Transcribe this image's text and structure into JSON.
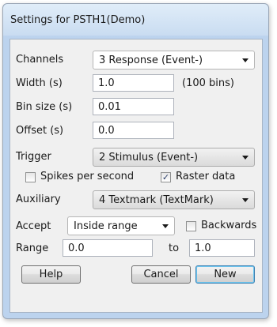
{
  "dialog": {
    "title": "Settings for PSTH1(Demo)"
  },
  "channels": {
    "label": "Channels",
    "value": "3 Response (Event-)"
  },
  "width": {
    "label": "Width (s)",
    "value": "1.0",
    "bins_note": "(100 bins)"
  },
  "bin_size": {
    "label": "Bin size (s)",
    "value": "0.01"
  },
  "offset": {
    "label": "Offset (s)",
    "value": "0.0"
  },
  "trigger": {
    "label": "Trigger",
    "value": "2 Stimulus (Event-)"
  },
  "spikes_per_second": {
    "label": "Spikes per second",
    "checked": false
  },
  "raster_data": {
    "label": "Raster data",
    "checked": true
  },
  "auxiliary": {
    "label": "Auxiliary",
    "value": "4 Textmark (TextMark)"
  },
  "accept": {
    "label": "Accept",
    "value": "Inside range"
  },
  "backwards": {
    "label": "Backwards",
    "checked": false
  },
  "range": {
    "label": "Range",
    "from": "0.0",
    "to_label": "to",
    "to": "1.0"
  },
  "buttons": {
    "help": "Help",
    "cancel": "Cancel",
    "new": "New"
  },
  "glyphs": {
    "check": "✓"
  }
}
